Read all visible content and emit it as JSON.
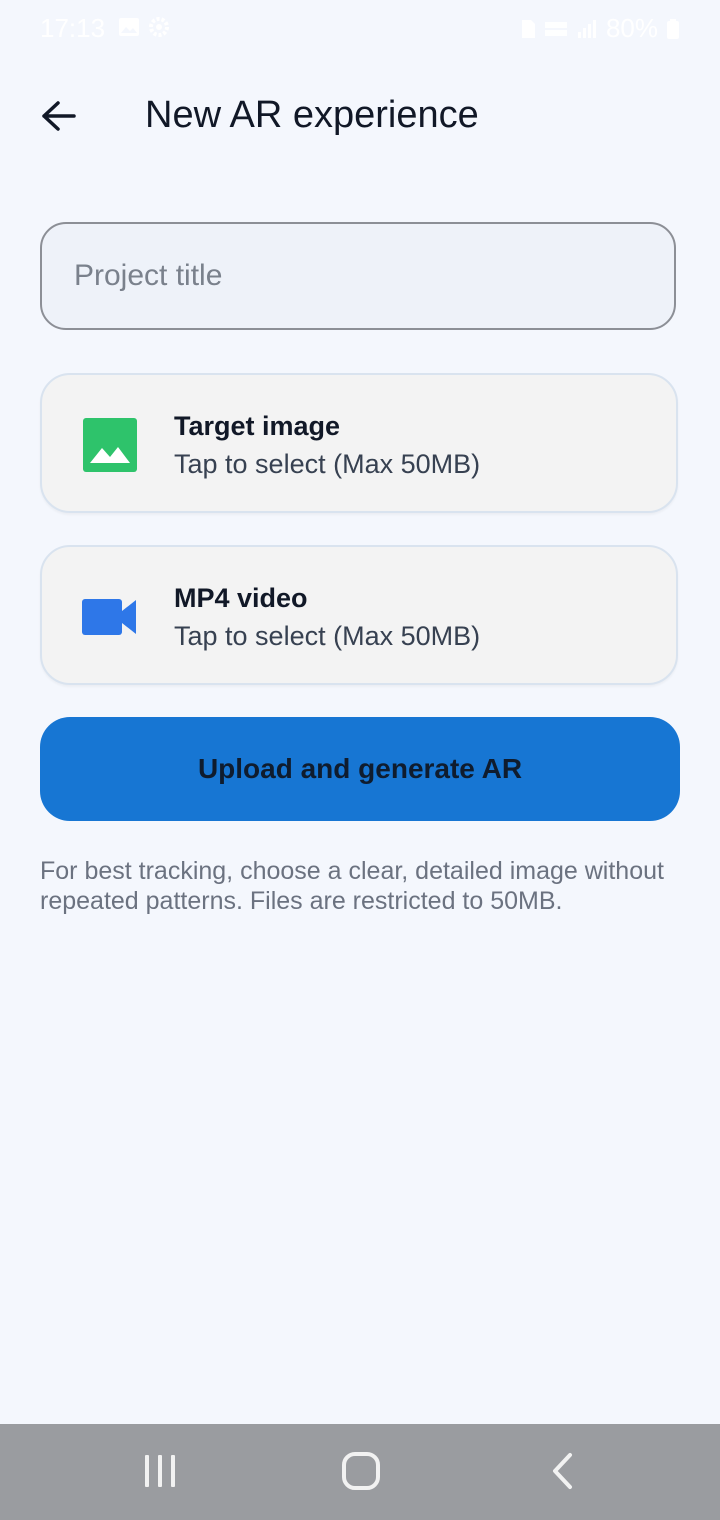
{
  "status_bar": {
    "time": "17:13",
    "battery": "80%",
    "icons": [
      "gallery-icon",
      "settings-icon",
      "sim-icon",
      "volte-icon",
      "signal-icon",
      "battery-icon"
    ]
  },
  "header": {
    "title": "New AR experience",
    "back_icon": "arrow-left-icon"
  },
  "form": {
    "title_placeholder": "Project title",
    "title_value": ""
  },
  "pickers": {
    "image": {
      "title": "Target image",
      "subtitle": "Tap to select (Max 50MB)",
      "icon": "image-icon",
      "icon_color": "#2ec36b"
    },
    "video": {
      "title": "MP4 video",
      "subtitle": "Tap to select (Max 50MB)",
      "icon": "videocam-icon",
      "icon_color": "#2e77e8"
    }
  },
  "actions": {
    "upload_label": "Upload and generate AR",
    "accent_color": "#1776d3"
  },
  "hint": {
    "text": "For best tracking, choose a clear, detailed image without repeated patterns. Files are restricted to 50MB."
  },
  "nav_bar": {
    "buttons": [
      "recent-apps-icon",
      "home-icon",
      "back-icon"
    ]
  }
}
